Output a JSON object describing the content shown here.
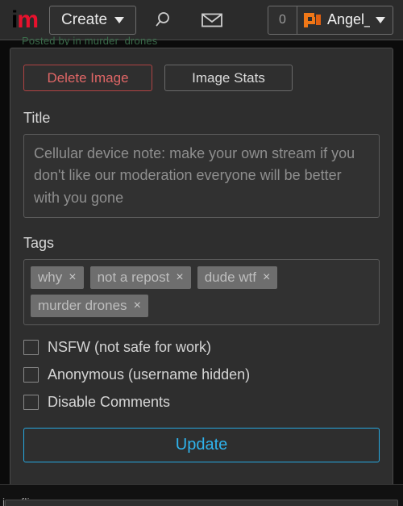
{
  "site": {
    "logo_first": "i",
    "logo_second": "m",
    "watermark": "imgflip.com"
  },
  "topbar": {
    "create_label": "Create",
    "search_icon": "search-icon",
    "messages_icon": "envelope-icon",
    "notification_count": "0",
    "username": "Angel_Du",
    "caret_icon": "chevron-down-icon"
  },
  "breadcrumb": {
    "partial_text": "Posted by in murder_drones"
  },
  "actions": {
    "delete_label": "Delete Image",
    "stats_label": "Image Stats"
  },
  "title_field": {
    "label": "Title",
    "value": "Cellular device note: make your own stream if you don't like our moderation everyone will be better with you gone"
  },
  "tags_field": {
    "label": "Tags",
    "remove_glyph": "×",
    "chips": [
      {
        "text": "why"
      },
      {
        "text": "not a repost"
      },
      {
        "text": "dude wtf"
      },
      {
        "text": "murder drones"
      }
    ]
  },
  "options": [
    {
      "label": "NSFW (not safe for work)",
      "checked": false
    },
    {
      "label": "Anonymous (username hidden)",
      "checked": false
    },
    {
      "label": "Disable Comments",
      "checked": false
    }
  ],
  "submit": {
    "label": "Update",
    "accent_color": "#2fb3ec"
  },
  "colors": {
    "page_background": "#0b0b0b",
    "card_background": "#2e2e2e",
    "topbar_background": "#2b2b2b",
    "danger": "#e06666",
    "brand_red": "#e8112d",
    "avatar_orange": "#f07818"
  }
}
